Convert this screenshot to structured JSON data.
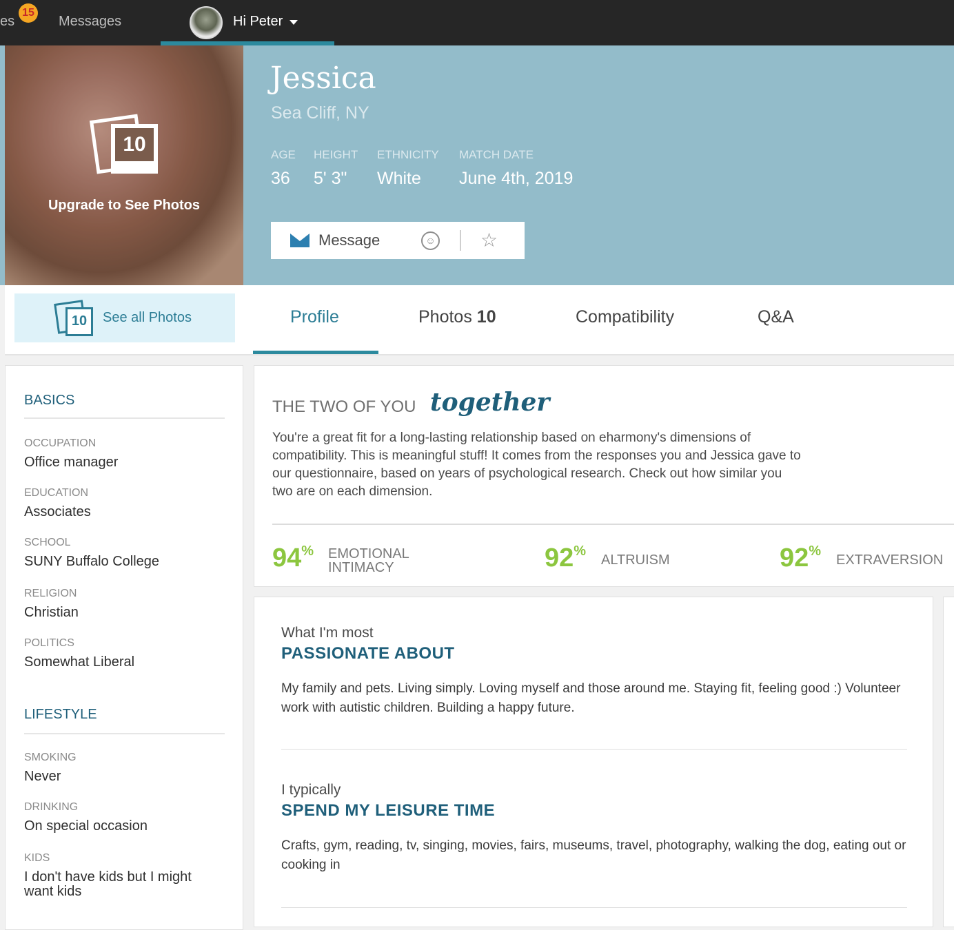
{
  "topnav": {
    "cut_label": "es",
    "badge_count": "15",
    "messages_label": "Messages",
    "greeting": "Hi Peter"
  },
  "profile": {
    "name": "Jessica",
    "location": "Sea Cliff, NY",
    "stats": [
      {
        "label": "AGE",
        "value": "36"
      },
      {
        "label": "HEIGHT",
        "value": "5' 3\""
      },
      {
        "label": "ETHNICITY",
        "value": "White"
      },
      {
        "label": "MATCH DATE",
        "value": "June 4th, 2019"
      }
    ],
    "photo_count": "10",
    "upgrade_text": "Upgrade to See Photos",
    "message_label": "Message"
  },
  "tabs": {
    "see_all_count": "10",
    "see_all_label": "See all Photos",
    "profile": "Profile",
    "photos": "Photos",
    "photos_count": "10",
    "compatibility": "Compatibility",
    "qa": "Q&A"
  },
  "basics": {
    "title": "BASICS",
    "fields": [
      {
        "label": "OCCUPATION",
        "value": "Office manager"
      },
      {
        "label": "EDUCATION",
        "value": "Associates"
      },
      {
        "label": "SCHOOL",
        "value": "SUNY Buffalo College"
      },
      {
        "label": "RELIGION",
        "value": "Christian"
      },
      {
        "label": "POLITICS",
        "value": "Somewhat Liberal"
      }
    ]
  },
  "lifestyle": {
    "title": "LIFESTYLE",
    "fields": [
      {
        "label": "SMOKING",
        "value": "Never"
      },
      {
        "label": "DRINKING",
        "value": "On special occasion"
      },
      {
        "label": "KIDS",
        "value_line1": "I don't have kids but I might",
        "value_line2": "want kids"
      }
    ]
  },
  "compatibility": {
    "heading": "THE TWO OF YOU",
    "script": "together",
    "paragraph": "You're a great fit for a long-lasting relationship based on eharmony's dimensions of compatibility. This is meaningful stuff! It comes from the responses you and Jessica gave to our questionnaire, based on years of psychological research. Check out how similar you two are on each dimension.",
    "metrics": [
      {
        "value": "94",
        "unit": "%",
        "label_line1": "EMOTIONAL",
        "label_line2": "INTIMACY"
      },
      {
        "value": "92",
        "unit": "%",
        "label_line1": "ALTRUISM"
      },
      {
        "value": "92",
        "unit": "%",
        "label_line1": "EXTRAVERSION"
      }
    ]
  },
  "essays": [
    {
      "pre": "What I'm most",
      "title": "PASSIONATE ABOUT",
      "body": "My family and pets. Living simply. Loving myself and those around me. Staying fit, feeling good :) Volunteer work with autistic children. Building a happy future."
    },
    {
      "pre": "I typically",
      "title": "SPEND MY LEISURE TIME",
      "body": "Crafts, gym, reading, tv, singing, movies, fairs, museums, travel, photography, walking the dog, eating out or cooking in"
    }
  ],
  "colors": {
    "hero_bg": "#93bcca",
    "accent_teal": "#2c7d95",
    "metric_green": "#8cc63f",
    "badge_orange": "#f5a623"
  }
}
